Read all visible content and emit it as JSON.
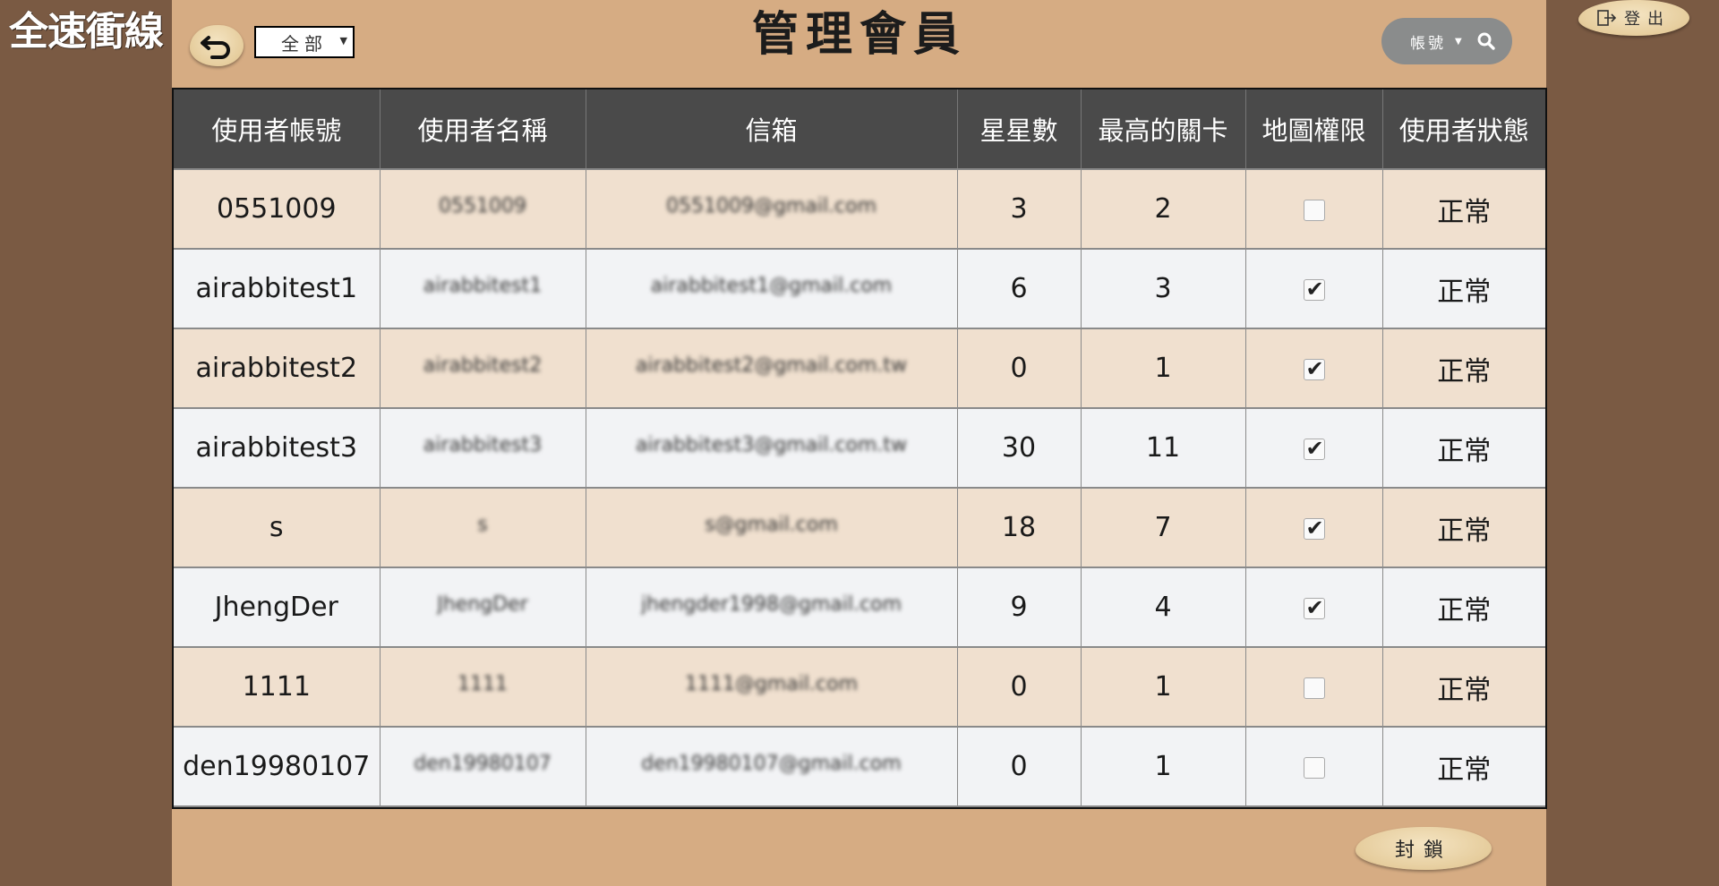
{
  "app": {
    "logo_text": "全速衝線",
    "title": "管理會員"
  },
  "filter": {
    "selected": "全部"
  },
  "search": {
    "field_label": "帳號"
  },
  "logout": {
    "label": "登出"
  },
  "table": {
    "headers": [
      "使用者帳號",
      "使用者名稱",
      "信箱",
      "星星數",
      "最高的關卡",
      "地圖權限",
      "使用者狀態"
    ],
    "rows": [
      {
        "account": "0551009",
        "name": "0551009",
        "email": "0551009@gmail.com",
        "stars": "3",
        "level": "2",
        "map": false,
        "status": "正常"
      },
      {
        "account": "airabbitest1",
        "name": "airabbitest1",
        "email": "airabbitest1@gmail.com",
        "stars": "6",
        "level": "3",
        "map": true,
        "status": "正常"
      },
      {
        "account": "airabbitest2",
        "name": "airabbitest2",
        "email": "airabbitest2@gmail.com.tw",
        "stars": "0",
        "level": "1",
        "map": true,
        "status": "正常"
      },
      {
        "account": "airabbitest3",
        "name": "airabbitest3",
        "email": "airabbitest3@gmail.com.tw",
        "stars": "30",
        "level": "11",
        "map": true,
        "status": "正常"
      },
      {
        "account": "s",
        "name": "s",
        "email": "s@gmail.com",
        "stars": "18",
        "level": "7",
        "map": true,
        "status": "正常"
      },
      {
        "account": "JhengDer",
        "name": "JhengDer",
        "email": "jhengder1998@gmail.com",
        "stars": "9",
        "level": "4",
        "map": true,
        "status": "正常"
      },
      {
        "account": "1111",
        "name": "1111",
        "email": "1111@gmail.com",
        "stars": "0",
        "level": "1",
        "map": false,
        "status": "正常"
      },
      {
        "account": "den19980107",
        "name": "den19980107",
        "email": "den19980107@gmail.com",
        "stars": "0",
        "level": "1",
        "map": false,
        "status": "正常"
      }
    ]
  },
  "actions": {
    "lock_label": "封鎖"
  }
}
